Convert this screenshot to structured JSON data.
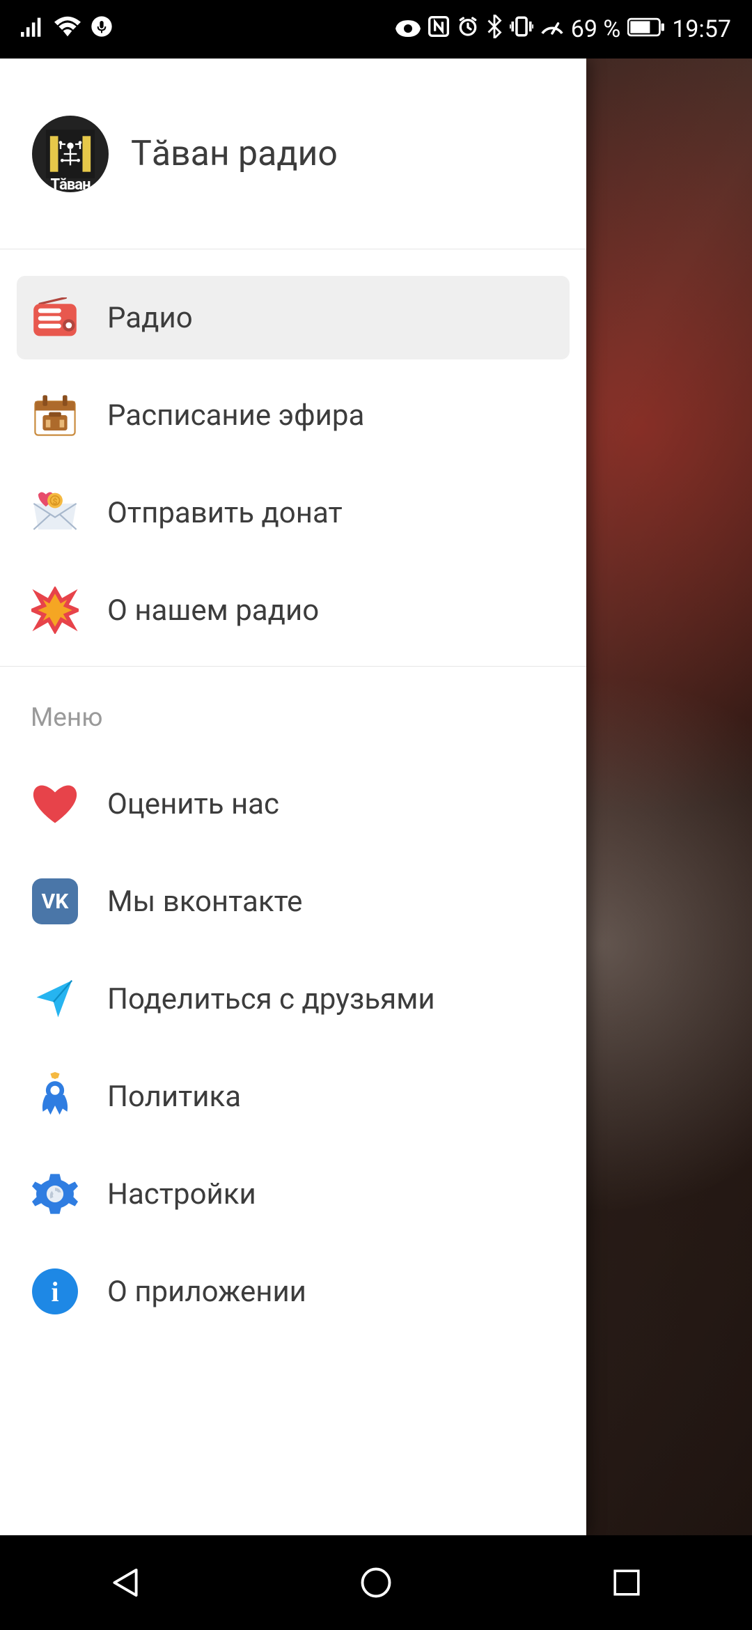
{
  "status": {
    "battery_pct": "69 %",
    "time": "19:57"
  },
  "drawer": {
    "app_title": "Тăван радио",
    "logo_word": "Тăван",
    "primary": [
      {
        "label": "Радио",
        "icon": "radio",
        "selected": true
      },
      {
        "label": "Расписание эфира",
        "icon": "schedule",
        "selected": false
      },
      {
        "label": "Отправить донат",
        "icon": "donate",
        "selected": false
      },
      {
        "label": "О нашем радио",
        "icon": "about-radio",
        "selected": false
      }
    ],
    "section_header": "Меню",
    "secondary": [
      {
        "label": "Оценить нас",
        "icon": "heart"
      },
      {
        "label": "Мы вконтакте",
        "icon": "vk"
      },
      {
        "label": "Поделиться с друзьями",
        "icon": "share"
      },
      {
        "label": "Политика",
        "icon": "policy"
      },
      {
        "label": "Настройки",
        "icon": "settings"
      },
      {
        "label": "О приложении",
        "icon": "info"
      }
    ]
  }
}
